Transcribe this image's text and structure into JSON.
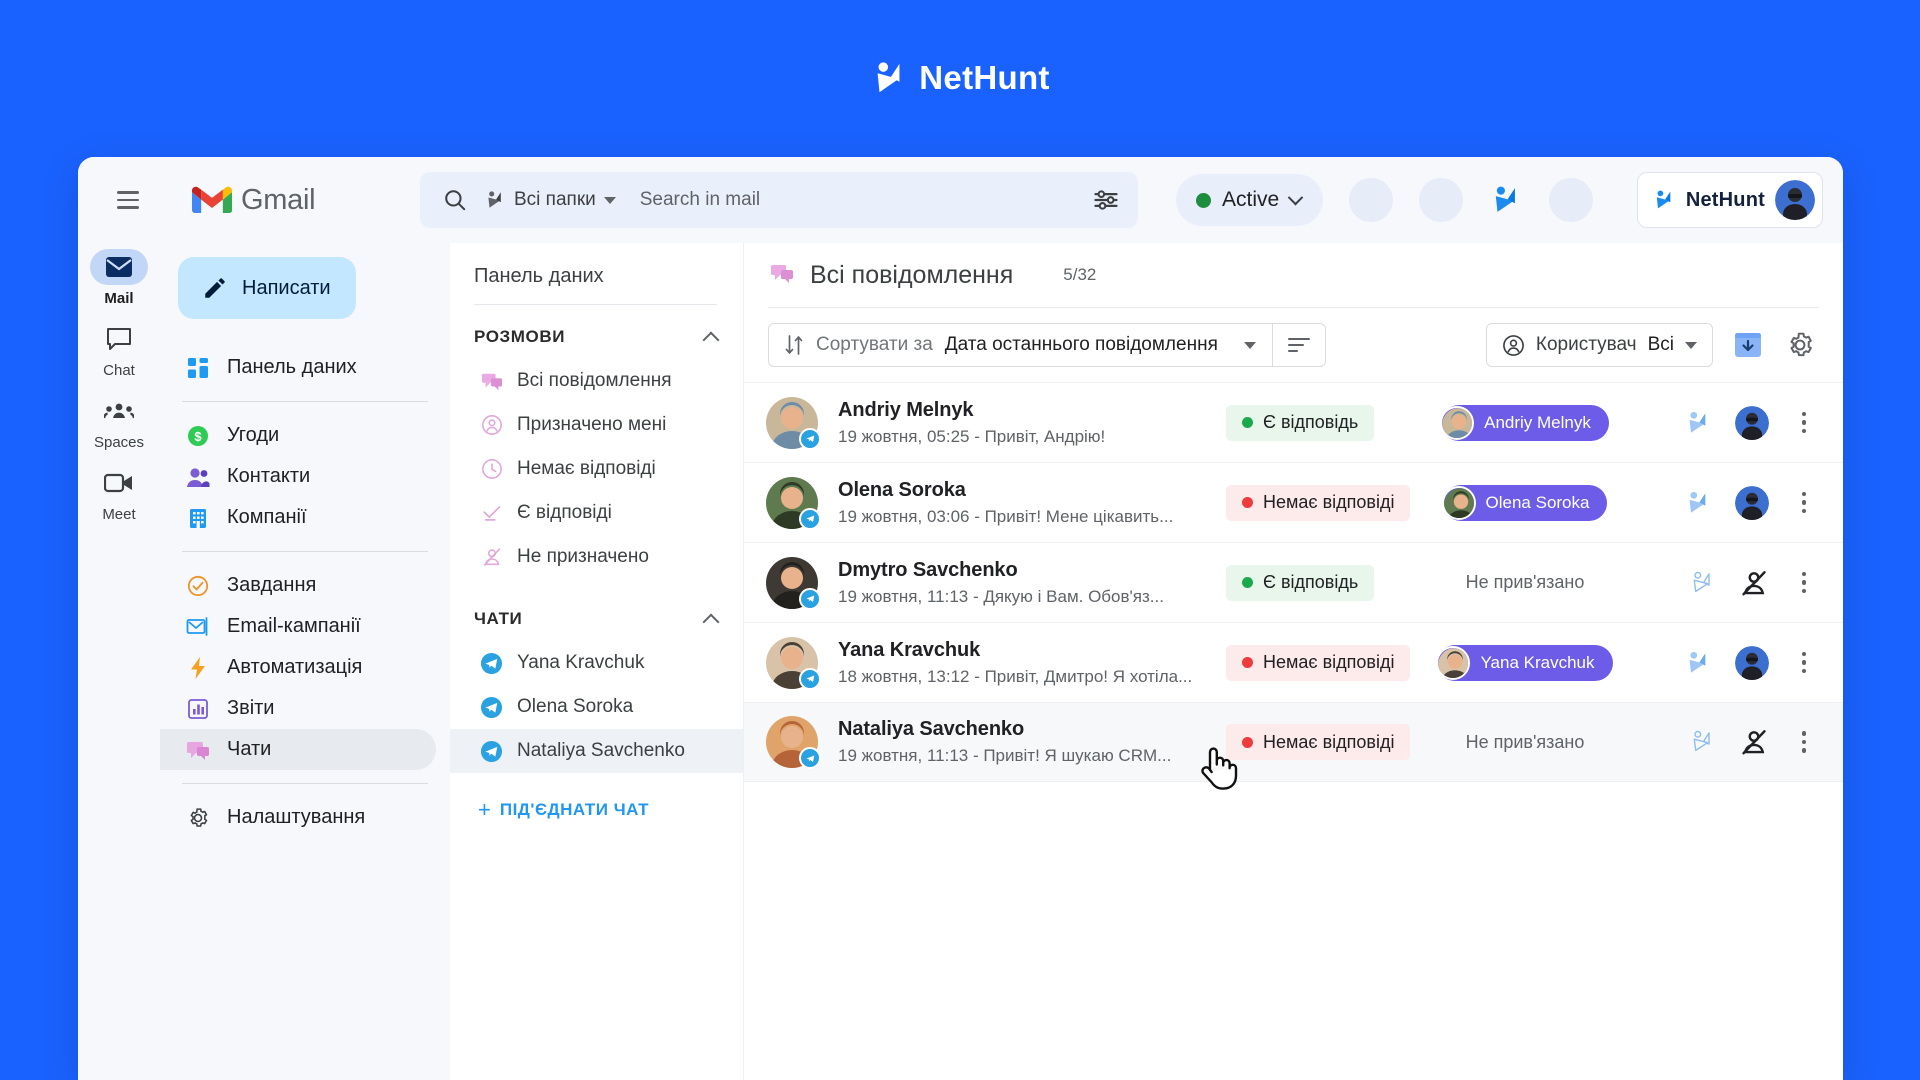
{
  "brand": {
    "name_net": "Net",
    "name_hunt": "Hunt"
  },
  "topbar": {
    "menu_icon": "hamburger-menu-icon",
    "gmail_label": "Gmail",
    "search": {
      "search_icon": "search-icon",
      "folder_label": "Всі папки",
      "placeholder": "Search in mail",
      "value": "",
      "options_icon": "search-options-icon"
    },
    "status": {
      "label": "Active",
      "color": "#1e8e3e"
    },
    "nethunt_icon": "nethunt-arrow-icon",
    "account": {
      "brand_net": "Net",
      "brand_hunt": "Hunt",
      "avatar": "user-avatar"
    }
  },
  "rail": {
    "items": [
      {
        "label": "Mail",
        "icon": "mail-icon",
        "active": true
      },
      {
        "label": "Chat",
        "icon": "chat-icon",
        "active": false
      },
      {
        "label": "Spaces",
        "icon": "spaces-icon",
        "active": false
      },
      {
        "label": "Meet",
        "icon": "meet-icon",
        "active": false
      }
    ]
  },
  "gmail_nav": {
    "compose_label": "Написати",
    "items": [
      {
        "label": "Панель даних",
        "icon": "dashboard-icon"
      },
      {
        "label": "Угоди",
        "icon": "deals-icon"
      },
      {
        "label": "Контакти",
        "icon": "contacts-icon"
      },
      {
        "label": "Компанії",
        "icon": "companies-icon"
      },
      {
        "label": "Завдання",
        "icon": "tasks-icon"
      },
      {
        "label": "Email-кампанії",
        "icon": "email-campaigns-icon"
      },
      {
        "label": "Автоматизація",
        "icon": "automation-icon"
      },
      {
        "label": "Звіти",
        "icon": "reports-icon"
      },
      {
        "label": "Чати",
        "icon": "chats-icon"
      },
      {
        "label": "Налаштування",
        "icon": "settings-icon"
      }
    ]
  },
  "folder_panel": {
    "header": "Панель даних",
    "sections": [
      {
        "title": "РОЗМОВИ",
        "items": [
          {
            "label": "Всі повідомлення",
            "icon": "all-messages-icon"
          },
          {
            "label": "Призначено мені",
            "icon": "assigned-to-me-icon"
          },
          {
            "label": "Немає відповіді",
            "icon": "no-reply-icon"
          },
          {
            "label": "Є відповіді",
            "icon": "has-reply-icon"
          },
          {
            "label": "Не призначено",
            "icon": "unassigned-icon"
          }
        ]
      },
      {
        "title": "ЧАТИ",
        "items": [
          {
            "label": "Yana Kravchuk",
            "icon": "telegram-icon"
          },
          {
            "label": "Olena Soroka",
            "icon": "telegram-icon"
          },
          {
            "label": "Nataliya Savchenko",
            "icon": "telegram-icon"
          }
        ]
      }
    ],
    "connect_chat_label": "ПІД'ЄДНАТИ ЧАТ"
  },
  "main": {
    "title": "Всі повідомлення",
    "count": "5/32",
    "toolbar": {
      "sort_prefix": "Сортувати за",
      "sort_value": "Дата останнього повідомлення",
      "density_icon": "list-density-icon",
      "user_prefix": "Користувач",
      "user_value": "Всі",
      "import_icon": "import-icon",
      "settings_icon": "gear-icon"
    },
    "rows": [
      {
        "name": "Andriy Melnyk",
        "preview": "19 жовтня, 05:25 - Привіт, Андрію!",
        "status": "Є відповідь",
        "status_type": "ok",
        "contact": "Andriy Melnyk",
        "linked": true,
        "assigned": true,
        "hovered": false,
        "avatar_colors": [
          "#c9b79a",
          "#6f8ca6"
        ]
      },
      {
        "name": "Olena Soroka",
        "preview": "19 жовтня, 03:06 - Привіт! Мене цікавить...",
        "status": "Немає відповіді",
        "status_type": "no",
        "contact": "Olena Soroka",
        "linked": true,
        "assigned": true,
        "hovered": false,
        "avatar_colors": [
          "#5f7a4e",
          "#2e3a26"
        ]
      },
      {
        "name": "Dmytro Savchenko",
        "preview": "19 жовтня, 11:13 - Дякую і Вам. Обов'яз...",
        "status": "Є відповідь",
        "status_type": "ok",
        "contact": "Не прив'язано",
        "linked": false,
        "assigned": false,
        "hovered": false,
        "avatar_colors": [
          "#3e3a33",
          "#23211d"
        ]
      },
      {
        "name": "Yana Kravchuk",
        "preview": "18 жовтня, 13:12 - Привіт, Дмитро! Я хотіла...",
        "status": "Немає відповіді",
        "status_type": "no",
        "contact": "Yana Kravchuk",
        "linked": true,
        "assigned": true,
        "hovered": false,
        "avatar_colors": [
          "#d8c3a8",
          "#4a4036"
        ]
      },
      {
        "name": "Nataliya Savchenko",
        "preview": "19 жовтня, 11:13 - Привіт! Я шукаю CRM...",
        "status": "Немає відповіді",
        "status_type": "no",
        "contact": "Не прив'язано",
        "linked": false,
        "assigned": false,
        "hovered": true,
        "avatar_colors": [
          "#e0a46a",
          "#b5643a"
        ]
      }
    ]
  },
  "colors": {
    "page_bg": "#1a62ff",
    "accent": "#2196f3",
    "chip_purple": "#6c5ce7",
    "status_ok": "#1ca94c",
    "status_no": "#ef3b3b"
  }
}
